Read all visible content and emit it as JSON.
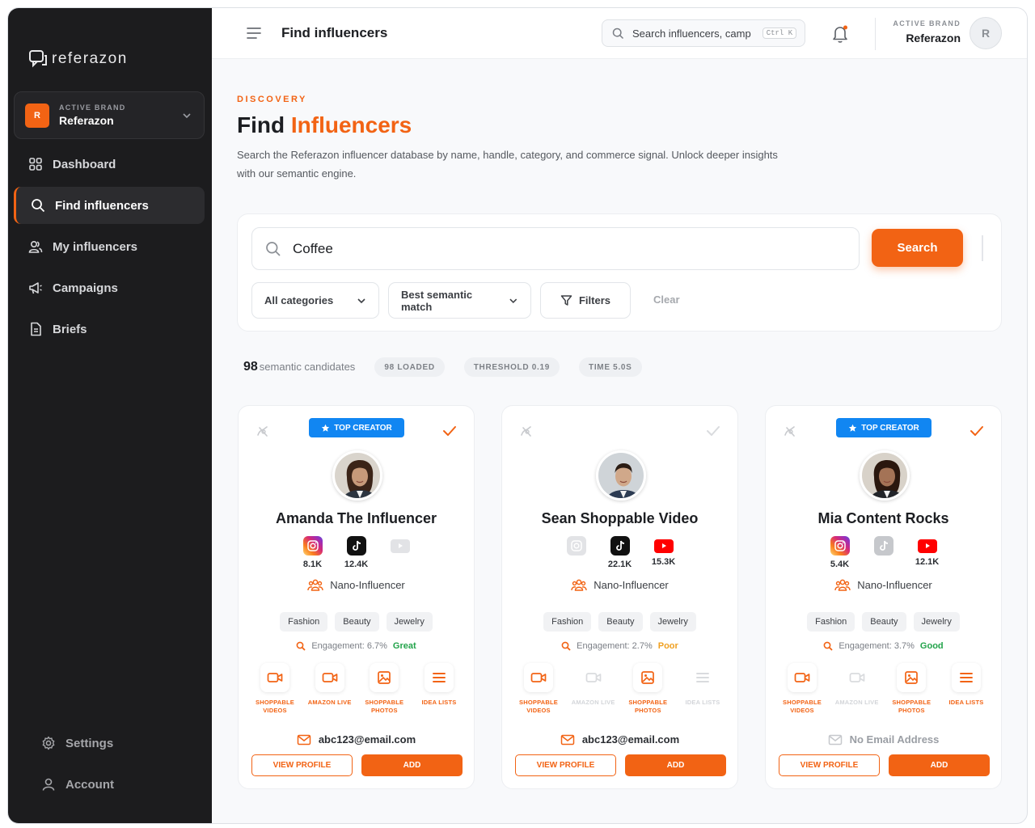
{
  "app": {
    "name": "referazon"
  },
  "sidebar": {
    "brand_label": "ACTIVE BRAND",
    "brand_name": "Referazon",
    "brand_initial": "R",
    "items": [
      {
        "label": "Dashboard",
        "icon": "grid-icon"
      },
      {
        "label": "Find influencers",
        "icon": "search-icon",
        "active": true
      },
      {
        "label": "My influencers",
        "icon": "users-icon"
      },
      {
        "label": "Campaigns",
        "icon": "megaphone-icon"
      },
      {
        "label": "Briefs",
        "icon": "document-icon"
      }
    ],
    "bottom": [
      {
        "label": "Settings",
        "icon": "gear-icon"
      },
      {
        "label": "Account",
        "icon": "user-icon"
      }
    ]
  },
  "topbar": {
    "title": "Find influencers",
    "search_placeholder": "Search influencers, camp",
    "shortcut": "Ctrl K",
    "brand_label": "ACTIVE BRAND",
    "brand_name": "Referazon",
    "avatar_initial": "R"
  },
  "page": {
    "eyebrow": "DISCOVERY",
    "title_plain": "Find ",
    "title_accent": "Influencers",
    "description": "Search the Referazon influencer database by name, handle, category, and commerce signal. Unlock deeper insights with our semantic engine."
  },
  "search": {
    "value": "Coffee",
    "button": "Search",
    "category": "All categories",
    "sort": "Best semantic match",
    "filters": "Filters",
    "clear": "Clear"
  },
  "stats": {
    "count": "98",
    "count_label": "semantic candidates",
    "chips": [
      "98 LOADED",
      "THRESHOLD 0.19",
      "TIME 5.0S"
    ]
  },
  "colors": {
    "accent": "#f26314",
    "top_creator": "#1186f2",
    "great": "#22a34a",
    "poor": "#f0a020",
    "good": "#22a34a"
  },
  "cards": [
    {
      "top_creator": true,
      "top_creator_label": "TOP CREATOR",
      "selected": true,
      "name": "Amanda The Influencer",
      "instagram": {
        "value": "8.1K",
        "active": true
      },
      "tiktok": {
        "value": "12.4K",
        "active": true
      },
      "youtube": {
        "value": "",
        "active": false
      },
      "tier": "Nano-Influencer",
      "tags": [
        "Fashion",
        "Beauty",
        "Jewelry"
      ],
      "engagement_text": "Engagement: 6.7%",
      "engagement_quality": "Great",
      "features": [
        {
          "label": "SHOPPABLE VIDEOS",
          "on": true,
          "icon": "video-icon"
        },
        {
          "label": "AMAZON LIVE",
          "on": true,
          "icon": "video-icon"
        },
        {
          "label": "SHOPPABLE PHOTOS",
          "on": true,
          "icon": "image-icon"
        },
        {
          "label": "IDEA LISTS",
          "on": true,
          "icon": "list-icon"
        }
      ],
      "email": "abc123@email.com",
      "has_email": true,
      "view_label": "VIEW PROFILE",
      "add_label": "ADD"
    },
    {
      "top_creator": false,
      "top_creator_label": "",
      "selected": false,
      "name": "Sean Shoppable Video",
      "instagram": {
        "value": "",
        "active": false
      },
      "tiktok": {
        "value": "22.1K",
        "active": true
      },
      "youtube": {
        "value": "15.3K",
        "active": true
      },
      "tier": "Nano-Influencer",
      "tags": [
        "Fashion",
        "Beauty",
        "Jewelry"
      ],
      "engagement_text": "Engagement: 2.7%",
      "engagement_quality": "Poor",
      "features": [
        {
          "label": "SHOPPABLE VIDEOS",
          "on": true,
          "icon": "video-icon"
        },
        {
          "label": "AMAZON LIVE",
          "on": false,
          "icon": "video-icon"
        },
        {
          "label": "SHOPPABLE PHOTOS",
          "on": true,
          "icon": "image-icon"
        },
        {
          "label": "IDEA LISTS",
          "on": false,
          "icon": "list-icon"
        }
      ],
      "email": "abc123@email.com",
      "has_email": true,
      "view_label": "VIEW PROFILE",
      "add_label": "ADD"
    },
    {
      "top_creator": true,
      "top_creator_label": "TOP CREATOR",
      "selected": true,
      "name": "Mia Content Rocks",
      "instagram": {
        "value": "5.4K",
        "active": true
      },
      "tiktok": {
        "value": "",
        "active": false
      },
      "youtube": {
        "value": "12.1K",
        "active": true
      },
      "tier": "Nano-Influencer",
      "tags": [
        "Fashion",
        "Beauty",
        "Jewelry"
      ],
      "engagement_text": "Engagement: 3.7%",
      "engagement_quality": "Good",
      "features": [
        {
          "label": "SHOPPABLE VIDEOS",
          "on": true,
          "icon": "video-icon"
        },
        {
          "label": "AMAZON LIVE",
          "on": false,
          "icon": "video-icon"
        },
        {
          "label": "SHOPPABLE PHOTOS",
          "on": true,
          "icon": "image-icon"
        },
        {
          "label": "IDEA LISTS",
          "on": true,
          "icon": "list-icon"
        }
      ],
      "email": "No Email Address",
      "has_email": false,
      "view_label": "VIEW PROFILE",
      "add_label": "ADD"
    }
  ]
}
